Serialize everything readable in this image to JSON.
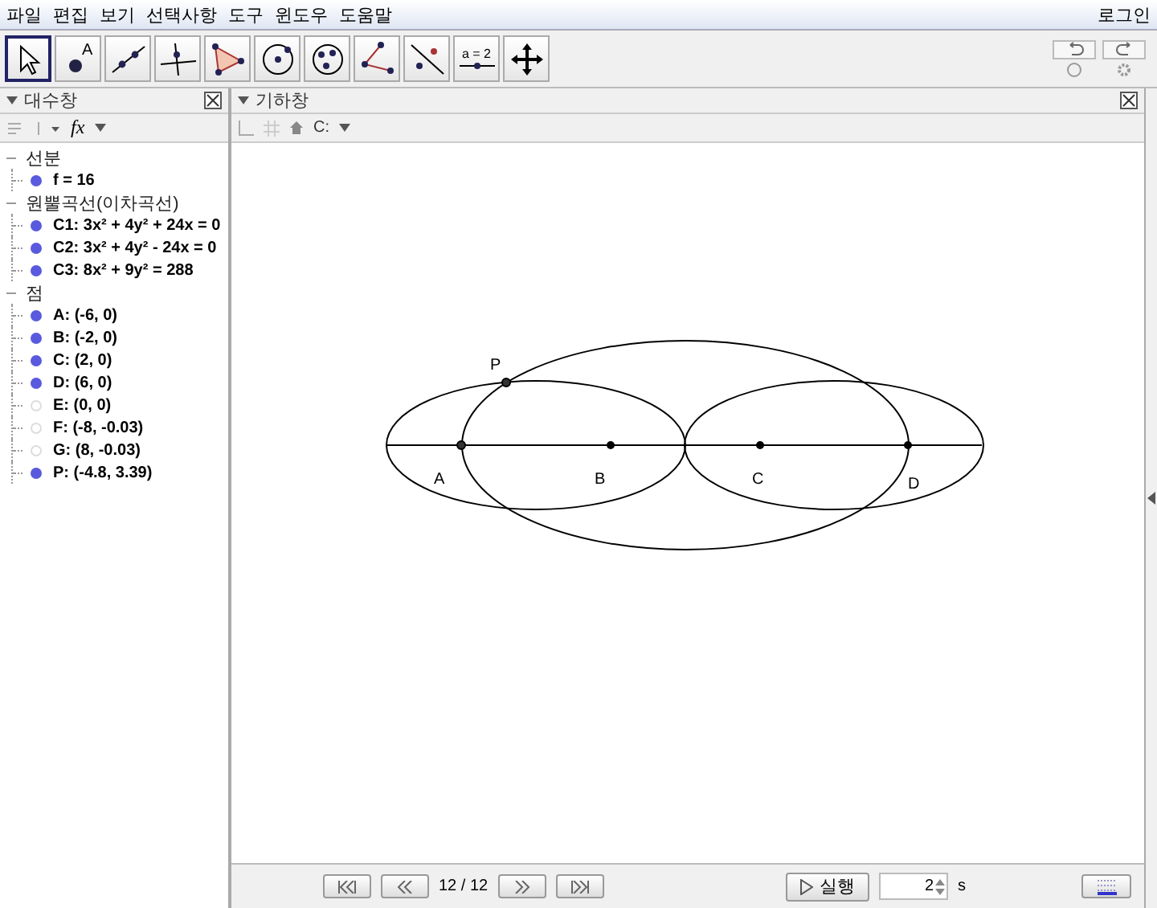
{
  "menu": {
    "items": [
      "파일",
      "편집",
      "보기",
      "선택사항",
      "도구",
      "윈도우",
      "도움말"
    ],
    "login": "로그인"
  },
  "toolbar": {
    "tools": [
      {
        "kind": "move",
        "selected": true
      },
      {
        "kind": "point",
        "label": "A",
        "selected": false
      },
      {
        "kind": "line",
        "selected": false
      },
      {
        "kind": "perpendicular",
        "selected": false
      },
      {
        "kind": "polygon",
        "selected": false
      },
      {
        "kind": "circle",
        "selected": false
      },
      {
        "kind": "conic",
        "selected": false
      },
      {
        "kind": "angle",
        "selected": false
      },
      {
        "kind": "reflect",
        "selected": false
      },
      {
        "kind": "slider",
        "label": "a = 2",
        "selected": false
      },
      {
        "kind": "pan",
        "selected": false
      }
    ]
  },
  "algebra_view": {
    "title": "대수창",
    "fx": "fx",
    "groups": [
      {
        "label": "선분",
        "children": [
          {
            "text": "f = 16",
            "visible": true
          }
        ]
      },
      {
        "label": "원뿔곡선(이차곡선)",
        "children": [
          {
            "text": "C1: 3x² + 4y² + 24x = 0",
            "visible": true
          },
          {
            "text": "C2: 3x² + 4y² - 24x = 0",
            "visible": true
          },
          {
            "text": "C3: 8x² + 9y² = 288",
            "visible": true
          }
        ]
      },
      {
        "label": "점",
        "children": [
          {
            "text": "A: (-6, 0)",
            "visible": true
          },
          {
            "text": "B: (-2, 0)",
            "visible": true
          },
          {
            "text": "C: (2, 0)",
            "visible": true
          },
          {
            "text": "D: (6, 0)",
            "visible": true
          },
          {
            "text": "E: (0, 0)",
            "visible": false
          },
          {
            "text": "F: (-8, -0.03)",
            "visible": false
          },
          {
            "text": "G: (8, -0.03)",
            "visible": false
          },
          {
            "text": "P: (-4.8, 3.39)",
            "visible": true
          }
        ]
      }
    ]
  },
  "graphics_view": {
    "title": "기하창",
    "style_label": "C:",
    "point_labels": [
      "P",
      "A",
      "B",
      "C",
      "D"
    ]
  },
  "navigation": {
    "counter": "12 / 12",
    "play": "실행",
    "speed": "2",
    "unit": "s"
  }
}
